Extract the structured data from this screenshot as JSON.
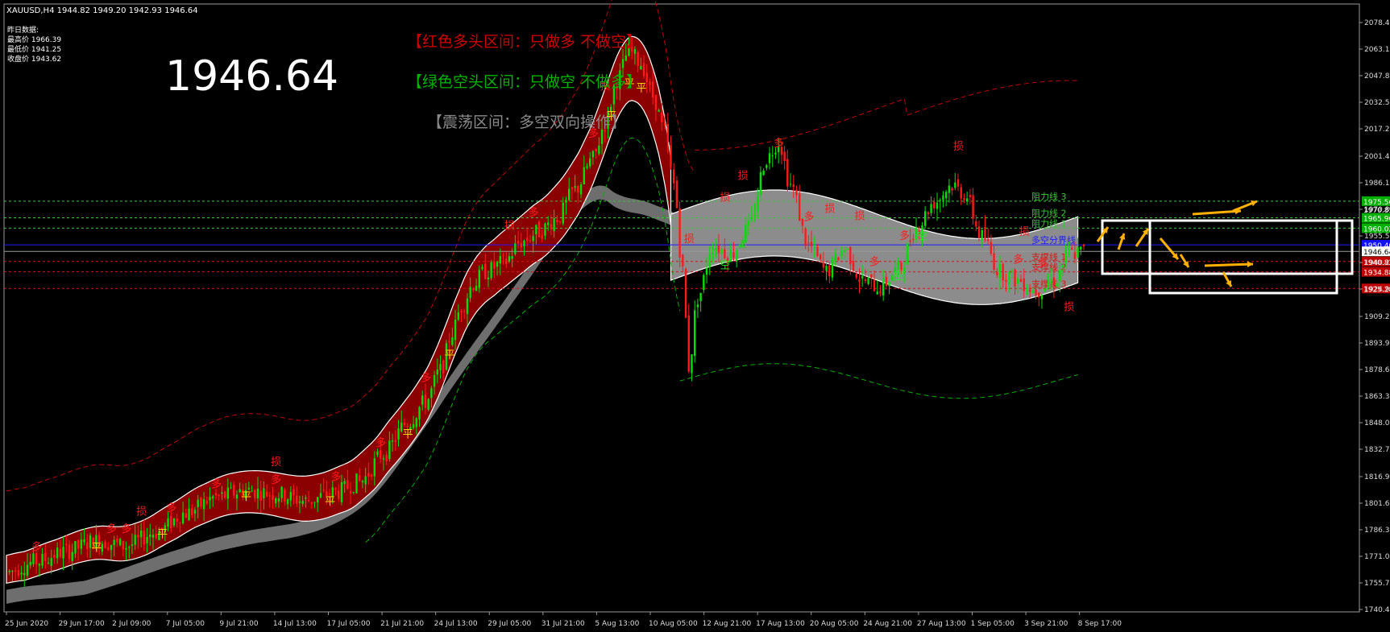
{
  "window": {
    "symbol_line": "XAUUSD,H4  1944.82 1949.20 1942.93 1946.64"
  },
  "info_box": {
    "title": "昨日数据:",
    "high": "最高价 1966.39",
    "low": "最低价 1941.25",
    "close": "收盘价 1943.62"
  },
  "big_price": "1946.64",
  "legend": {
    "red_zone": "【红色多头区间：只做多 不做空】",
    "green_zone": "【绿色空头区间：只做空 不做多】",
    "range_zone": "【震荡区间：多空双向操作】"
  },
  "level_labels": {
    "resistance_3": "阻力线 3",
    "resistance_2": "阻力线 2",
    "resistance_1": "阻力线 1",
    "pivot": "多空分界线",
    "support_1": "支撑线 1",
    "support_2": "支撑线 2",
    "support_3": "支撑线 3"
  },
  "markers": {
    "long": "多",
    "short": "空",
    "flat": "平",
    "stop": "损"
  },
  "colors": {
    "background": "#000000",
    "bull_candle": "#00e000",
    "bear_candle": "#ff1a1a",
    "bull_band": "#8b0000",
    "range_band": "#8c8c8c",
    "slow_band": "#6e6e6e",
    "pivot_line": "#1c1cff",
    "resistance_line": "#33cc33",
    "support_line": "#e01010",
    "arrow": "#ffb000",
    "forecast_box": "#ffffff",
    "flat_marker": "#ffd700"
  },
  "chart_data": {
    "type": "candlestick",
    "x_ticks": [
      "25 Jun 2020",
      "29 Jun 17:00",
      "2 Jul 09:00",
      "7 Jul 05:00",
      "9 Jul 21:00",
      "14 Jul 13:00",
      "17 Jul 05:00",
      "21 Jul 21:00",
      "24 Jul 13:00",
      "29 Jul 05:00",
      "31 Jul 21:00",
      "5 Aug 13:00",
      "10 Aug 05:00",
      "12 Aug 21:00",
      "17 Aug 13:00",
      "20 Aug 05:00",
      "24 Aug 21:00",
      "27 Aug 13:00",
      "1 Sep 05:00",
      "3 Sep 21:00",
      "8 Sep 17:00"
    ],
    "y_ticks": [
      "2078.40",
      "2063.10",
      "2047.80",
      "2032.50",
      "2017.20",
      "2001.45",
      "1986.15",
      "1970.85",
      "1955.55",
      "1940.25",
      "1924.95",
      "1909.20",
      "1893.90",
      "1878.60",
      "1863.30",
      "1848.00",
      "1832.70",
      "1816.95",
      "1801.65",
      "1786.35",
      "1771.05",
      "1755.75",
      "1740.45"
    ],
    "ylim": [
      1740.45,
      2078.4
    ],
    "current_price": 1946.64,
    "price_path": [
      [
        0,
        1762
      ],
      [
        10,
        1768
      ],
      [
        20,
        1774
      ],
      [
        30,
        1780
      ],
      [
        40,
        1777
      ],
      [
        50,
        1785
      ],
      [
        60,
        1796
      ],
      [
        70,
        1805
      ],
      [
        80,
        1809
      ],
      [
        90,
        1807
      ],
      [
        100,
        1803
      ],
      [
        110,
        1808
      ],
      [
        118,
        1814
      ],
      [
        126,
        1830
      ],
      [
        134,
        1848
      ],
      [
        140,
        1860
      ],
      [
        145,
        1878
      ],
      [
        149,
        1900
      ],
      [
        152,
        1915
      ],
      [
        156,
        1928
      ],
      [
        160,
        1935
      ],
      [
        166,
        1940
      ],
      [
        172,
        1952
      ],
      [
        178,
        1958
      ],
      [
        184,
        1966
      ],
      [
        190,
        1982
      ],
      [
        196,
        2000
      ],
      [
        200,
        2020
      ],
      [
        204,
        2045
      ],
      [
        208,
        2062
      ],
      [
        212,
        2055
      ],
      [
        216,
        2036
      ],
      [
        220,
        2015
      ],
      [
        223,
        1985
      ],
      [
        226,
        1935
      ],
      [
        228,
        1880
      ],
      [
        231,
        1920
      ],
      [
        236,
        1950
      ],
      [
        242,
        1945
      ],
      [
        248,
        1960
      ],
      [
        254,
        2000
      ],
      [
        258,
        2010
      ],
      [
        262,
        1985
      ],
      [
        268,
        1950
      ],
      [
        274,
        1935
      ],
      [
        280,
        1948
      ],
      [
        286,
        1930
      ],
      [
        292,
        1926
      ],
      [
        298,
        1936
      ],
      [
        304,
        1960
      ],
      [
        310,
        1975
      ],
      [
        316,
        1985
      ],
      [
        320,
        1980
      ],
      [
        326,
        1955
      ],
      [
        332,
        1935
      ],
      [
        338,
        1930
      ],
      [
        344,
        1924
      ],
      [
        350,
        1930
      ],
      [
        355,
        1945
      ],
      [
        360,
        1946.64
      ]
    ],
    "levels": [
      {
        "label_key": "resistance_3",
        "value": 1975.56,
        "label": "1975.56",
        "kind": "resistance"
      },
      {
        "label_key": "resistance_2",
        "value": 1965.96,
        "label": "1965.96",
        "kind": "resistance"
      },
      {
        "label_key": "resistance_1",
        "value": 1960.02,
        "label": "1960.02",
        "kind": "resistance"
      },
      {
        "label_key": "pivot",
        "value": 1950.4,
        "label": "1950.40",
        "kind": "pivot"
      },
      {
        "label_key": "support_1",
        "value": 1940.82,
        "label": "1940.82",
        "kind": "support"
      },
      {
        "label_key": "support_2",
        "value": 1934.88,
        "label": "1934.88",
        "kind": "support"
      },
      {
        "label_key": "support_3",
        "value": 1925.28,
        "label": "1925.28",
        "kind": "support"
      }
    ],
    "price_box_label": "1946.64",
    "top_price_label": "1970.85"
  }
}
